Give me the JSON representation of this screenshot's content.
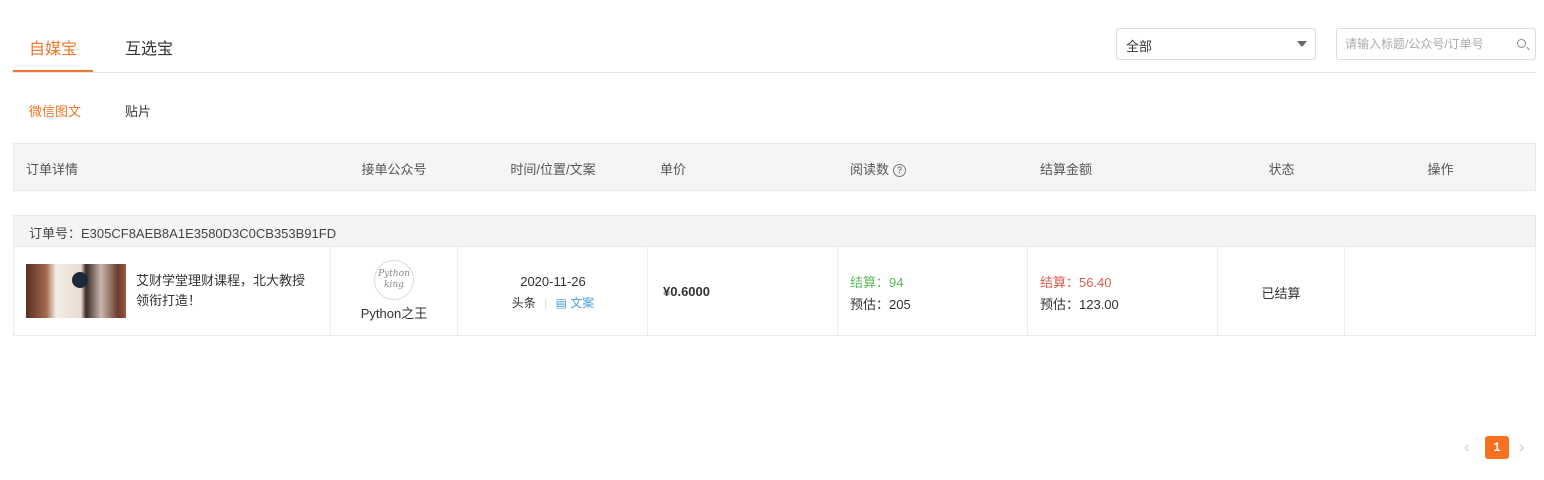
{
  "tabs": [
    {
      "label": "自媒宝",
      "active": true
    },
    {
      "label": "互选宝",
      "active": false
    }
  ],
  "filter": {
    "selected": "全部",
    "search_placeholder": "请输入标题/公众号/订单号"
  },
  "subtabs": [
    {
      "label": "微信图文",
      "active": true
    },
    {
      "label": "贴片",
      "active": false
    }
  ],
  "columns": [
    "订单详情",
    "接单公众号",
    "时间/位置/文案",
    "单价",
    "阅读数",
    "结算金额",
    "状态",
    "操作"
  ],
  "order": {
    "number_label": "订单号：E305CF8AEB8A1E3580D3C0CB353B91FD",
    "title": "艾财学堂理财课程，北大教授领衔打造！",
    "account": "Python之王",
    "avatar_text": "Python king",
    "date": "2020-11-26",
    "position": "头条",
    "copy_link": "文案",
    "price": "¥0.6000",
    "reads_settled": "结算：94",
    "reads_estimated": "预估：205",
    "amount_settled": "结算：56.40",
    "amount_estimated": "预估：123.00",
    "status": "已结算"
  },
  "pagination": {
    "current": "1",
    "prev": "‹",
    "next": "›"
  },
  "colors": {
    "accent": "#f0762b",
    "green": "#5cb85c",
    "red": "#e05a4f"
  }
}
